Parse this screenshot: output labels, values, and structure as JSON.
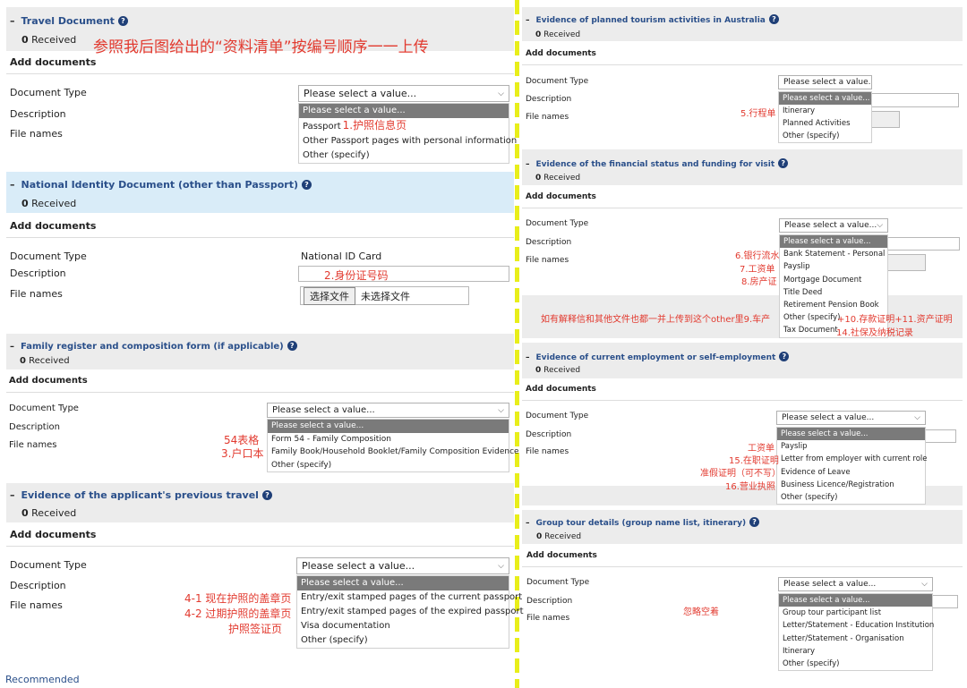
{
  "instruction": "参照我后图给出的“资料清单”按编号顺序一一上传",
  "common": {
    "add_documents": "Add documents",
    "document_type": "Document Type",
    "description": "Description",
    "file_names": "File names",
    "received_count": "0",
    "received_label": " Received",
    "select_placeholder": "Please select a value..."
  },
  "left": {
    "travel": {
      "title": "Travel Document",
      "options": [
        "Please select a value...",
        "Passport",
        "Other Passport pages with personal information",
        "Other (specify)"
      ],
      "notes": [
        "1.护照信息页"
      ]
    },
    "national": {
      "title": "National Identity Document (other than Passport)",
      "doc_type_value": "National ID Card",
      "note": "2.身份证号码",
      "choose_file": "选择文件",
      "no_file": "未选择文件"
    },
    "family": {
      "title": "Family register and composition form (if applicable)",
      "options": [
        "Please select a value...",
        "Form 54 - Family Composition",
        "Family Book/Household Booklet/Family Composition Evidence",
        "Other (specify)"
      ],
      "notes": [
        "54表格",
        "3.户口本"
      ]
    },
    "prev_travel": {
      "title": "Evidence of the applicant's previous travel",
      "options": [
        "Please select a value...",
        "Entry/exit stamped pages of the current passport",
        "Entry/exit stamped pages of the expired passport",
        "Visa documentation",
        "Other (specify)"
      ],
      "notes": [
        "4-1 现在护照的盖章页",
        "4-2 过期护照的盖章页",
        "护照签证页"
      ]
    },
    "recommended": "Recommended"
  },
  "right": {
    "tourism": {
      "title": "Evidence of planned tourism activities in Australia",
      "options": [
        "Please select a value...",
        "Itinerary",
        "Planned Activities",
        "Other (specify)"
      ],
      "notes": [
        "5.行程单"
      ]
    },
    "financial": {
      "title": "Evidence of the financial status and funding for visit",
      "options": [
        "Please select a value...",
        "Bank Statement - Personal",
        "Payslip",
        "Mortgage Document",
        "Title Deed",
        "Retirement Pension Book",
        "Other (specify)",
        "Tax Document"
      ],
      "notes": [
        "6.银行流水",
        "7.工资单",
        "8.房产证",
        "如有解释信和其他文件也都一并上传到这个other里9.车产",
        "+10.存款证明+11.资产证明",
        "14.社保及纳税记录"
      ]
    },
    "employment": {
      "title": "Evidence of current employment or self-employment",
      "options": [
        "Please select a value...",
        "Payslip",
        "Letter from employer with current role",
        "Evidence of Leave",
        "Business Licence/Registration",
        "Other (specify)"
      ],
      "notes": [
        "工资单",
        "15.在职证明",
        "准假证明（可不写）",
        "16.营业执照"
      ]
    },
    "group": {
      "title": "Group tour details (group name list, itinerary)",
      "options": [
        "Please select a value...",
        "Group tour participant list",
        "Letter/Statement - Education Institution",
        "Letter/Statement - Organisation",
        "Itinerary",
        "Other (specify)"
      ],
      "notes": [
        "忽略空着"
      ]
    }
  },
  "colors": {
    "title_blue": "#2a4f8a",
    "note_red": "#e23a2f",
    "divider_yellow": "#e8ee1a",
    "header_gray": "#ececec",
    "header_blue": "#d9ecf8",
    "selected_option": "#7a7a7a"
  }
}
